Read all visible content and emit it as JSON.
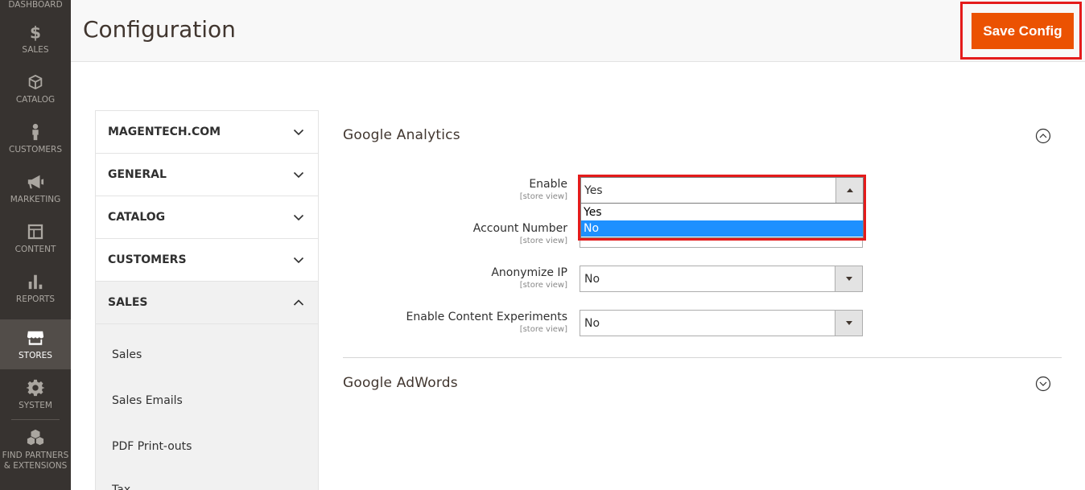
{
  "sidebar": {
    "top_label": "DASHBOARD",
    "items": [
      {
        "label": "SALES",
        "icon": "dollar-icon"
      },
      {
        "label": "CATALOG",
        "icon": "box-icon"
      },
      {
        "label": "CUSTOMERS",
        "icon": "person-icon"
      },
      {
        "label": "MARKETING",
        "icon": "megaphone-icon"
      },
      {
        "label": "CONTENT",
        "icon": "layout-icon"
      },
      {
        "label": "REPORTS",
        "icon": "bar-chart-icon"
      },
      {
        "label": "STORES",
        "icon": "store-icon",
        "active": true
      },
      {
        "label": "SYSTEM",
        "icon": "gear-icon"
      },
      {
        "label": "FIND PARTNERS & EXTENSIONS",
        "icon": "cubes-icon"
      }
    ]
  },
  "header": {
    "title": "Configuration",
    "save_label": "Save Config"
  },
  "tabs": {
    "sections": [
      {
        "label": "MAGENTECH.COM",
        "open": false
      },
      {
        "label": "GENERAL",
        "open": false
      },
      {
        "label": "CATALOG",
        "open": false
      },
      {
        "label": "CUSTOMERS",
        "open": false
      },
      {
        "label": "SALES",
        "open": true
      }
    ],
    "sales_items": [
      "Sales",
      "Sales Emails",
      "PDF Print-outs",
      "Tax"
    ]
  },
  "content": {
    "google_analytics": {
      "title": "Google Analytics",
      "fields": [
        {
          "label": "Enable",
          "scope": "[store view]",
          "value": "Yes",
          "options": [
            "Yes",
            "No"
          ],
          "highlighted_option": "No"
        },
        {
          "label": "Account Number",
          "scope": "[store view]",
          "value": ""
        },
        {
          "label": "Anonymize IP",
          "scope": "[store view]",
          "value": "No"
        },
        {
          "label": "Enable Content Experiments",
          "scope": "[store view]",
          "value": "No"
        }
      ]
    },
    "google_adwords": {
      "title": "Google AdWords"
    }
  },
  "colors": {
    "sidebar_bg": "#373330",
    "accent": "#eb5202",
    "highlight": "#e41b1b",
    "option_selected": "#1e90ff"
  }
}
